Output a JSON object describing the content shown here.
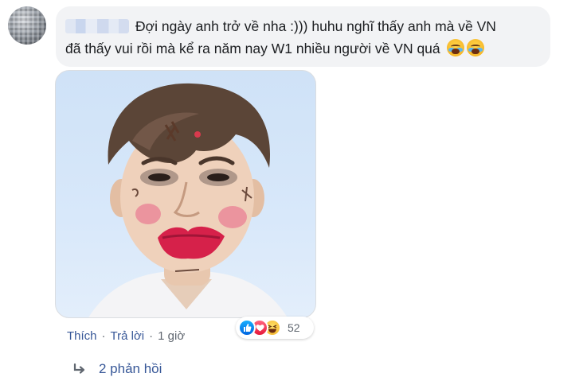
{
  "comment": {
    "text_line1": "Đợi ngày anh trở về nha :))) huhu nghĩ thấy anh mà về VN",
    "text_line2": "đã thấy vui rồi mà kể ra năm nay W1 nhiều người về VN quá",
    "emojis": [
      "loudly-crying-face-icon",
      "loudly-crying-face-icon"
    ]
  },
  "actions": {
    "like_label": "Thích",
    "separator": "·",
    "reply_label": "Trả lời",
    "time": "1 giờ"
  },
  "reactions": {
    "icons": [
      "like-icon",
      "love-icon",
      "haha-icon"
    ],
    "count": "52"
  },
  "replies": {
    "label": "2 phản hồi"
  },
  "colors": {
    "bubble_bg": "#f2f3f5",
    "link": "#385898",
    "muted": "#606770"
  }
}
